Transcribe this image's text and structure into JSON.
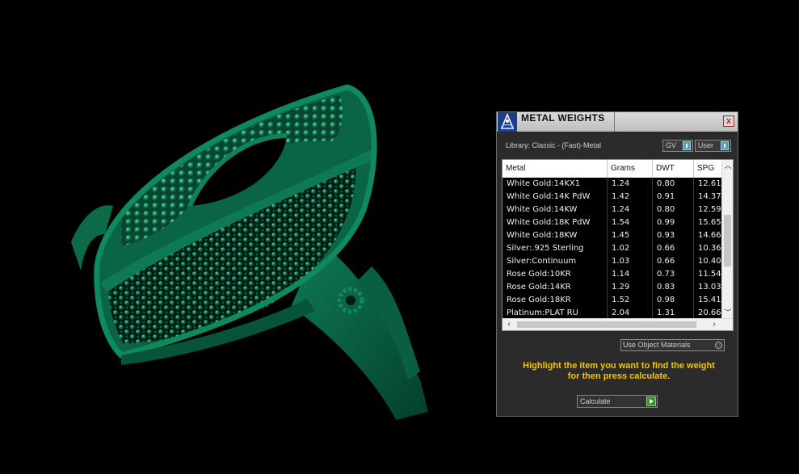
{
  "colors": {
    "metal_green": "#0c6b4a",
    "highlight_text": "#f5c400",
    "panel_bg": "#2b2b2b"
  },
  "panel": {
    "title": "METAL WEIGHTS",
    "close_label": "x",
    "library_label": "Library: Classic - (Fast)-Metal",
    "gv_toggle": "GV",
    "user_toggle": "User",
    "columns": [
      "Metal",
      "Grams",
      "DWT",
      "SPG"
    ],
    "rows": [
      {
        "metal": "White Gold:14KX1",
        "grams": "1.24",
        "dwt": "0.80",
        "spg": "12.61"
      },
      {
        "metal": "White Gold:14K PdW",
        "grams": "1.42",
        "dwt": "0.91",
        "spg": "14.37"
      },
      {
        "metal": "White Gold:14KW",
        "grams": "1.24",
        "dwt": "0.80",
        "spg": "12.59"
      },
      {
        "metal": "White Gold:18K PdW",
        "grams": "1.54",
        "dwt": "0.99",
        "spg": "15.65"
      },
      {
        "metal": "White Gold:18KW",
        "grams": "1.45",
        "dwt": "0.93",
        "spg": "14.66"
      },
      {
        "metal": "Silver:.925 Sterling",
        "grams": "1.02",
        "dwt": "0.66",
        "spg": "10.36"
      },
      {
        "metal": "Silver:Continuum",
        "grams": "1.03",
        "dwt": "0.66",
        "spg": "10.40"
      },
      {
        "metal": "Rose Gold:10KR",
        "grams": "1.14",
        "dwt": "0.73",
        "spg": "11.54"
      },
      {
        "metal": "Rose Gold:14KR",
        "grams": "1.29",
        "dwt": "0.83",
        "spg": "13.03"
      },
      {
        "metal": "Rose Gold:18KR",
        "grams": "1.52",
        "dwt": "0.98",
        "spg": "15.41"
      },
      {
        "metal": "Platinum:PLAT RU",
        "grams": "2.04",
        "dwt": "1.31",
        "spg": "20.66"
      }
    ],
    "use_object_materials_label": "Use Object Materials",
    "hint_line1": "Highlight the item you want to find the weight",
    "hint_line2": "for then press calculate.",
    "calculate_label": "Calculate"
  }
}
